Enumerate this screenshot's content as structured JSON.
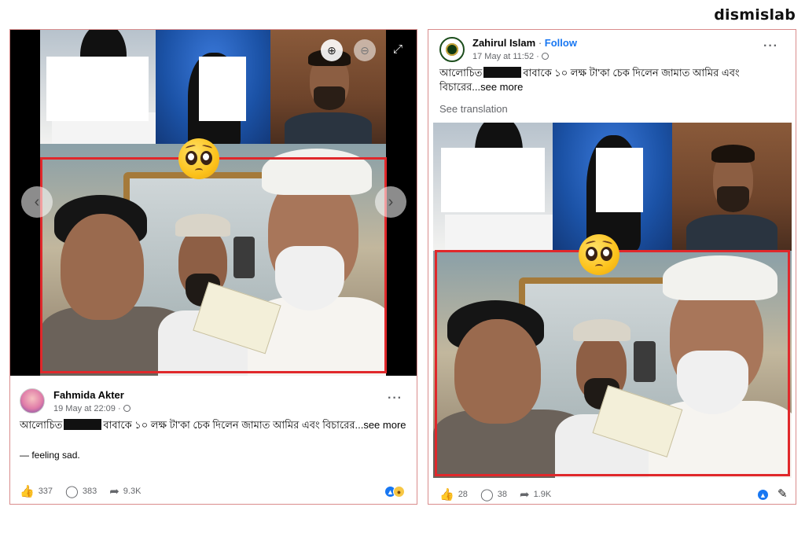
{
  "brand": "dismislab",
  "left_post": {
    "author": "Fahmida Akter",
    "timestamp": "19 May at 22:09",
    "more": "···",
    "text_before": "আলোচিত",
    "text_after": "বাবাকে ১০ লক্ষ টা'কা চেক দিলেন জামাত আমির এবং বিচারের...",
    "see_more": "see more",
    "feeling": "— feeling sad.",
    "likes": "337",
    "comments": "383",
    "shares": "9.3K",
    "icons": {
      "zoom_in": "⊕",
      "zoom_out": "⊖",
      "expand": "⤢",
      "prev": "‹",
      "next": "›",
      "like": "👍",
      "comment": "◯",
      "share": "➦"
    }
  },
  "right_post": {
    "author": "Zahirul Islam",
    "follow": "Follow",
    "timestamp": "17 May at 11:52",
    "more": "···",
    "text_before": "আলোচিত",
    "text_after": "বাবাকে ১০ লক্ষ টা'কা চেক দিলেন জামাত আমির এবং",
    "text_line2": "বিচারের...",
    "see_more": "see more",
    "see_translation": "See translation",
    "likes": "28",
    "comments": "38",
    "shares": "1.9K"
  },
  "colors": {
    "highlight_box": "#e0282b",
    "panel_border": "#d98c8c",
    "facebook_blue": "#1877f2"
  }
}
